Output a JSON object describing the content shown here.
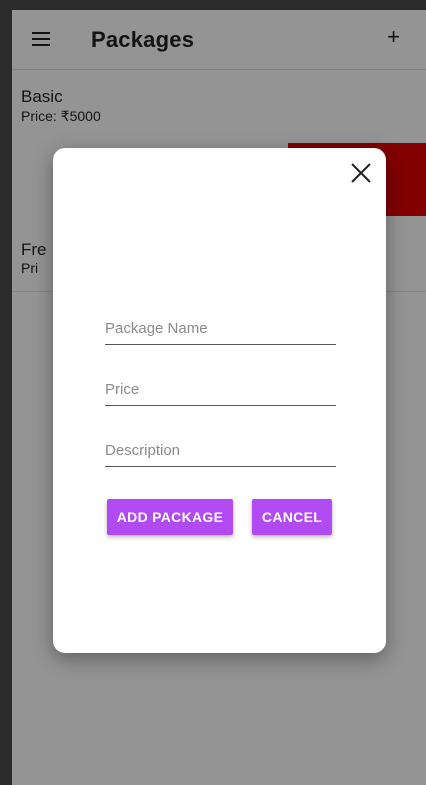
{
  "app_bar": {
    "title": "Packages",
    "menu_icon": "hamburger-menu-icon",
    "add_icon": "+"
  },
  "packages": [
    {
      "name": "Basic",
      "price": "Price: ₹5000"
    },
    {
      "name": "Fre",
      "price": "Pri"
    }
  ],
  "dialog": {
    "close_icon": "close-icon",
    "fields": {
      "package_name_placeholder": "Package Name",
      "price_placeholder": "Price",
      "description_placeholder": "Description"
    },
    "add_button_label": "ADD PACKAGE",
    "cancel_button_label": "CANCEL"
  },
  "colors": {
    "accent": "#b14af0",
    "delete_red": "#e00000"
  }
}
